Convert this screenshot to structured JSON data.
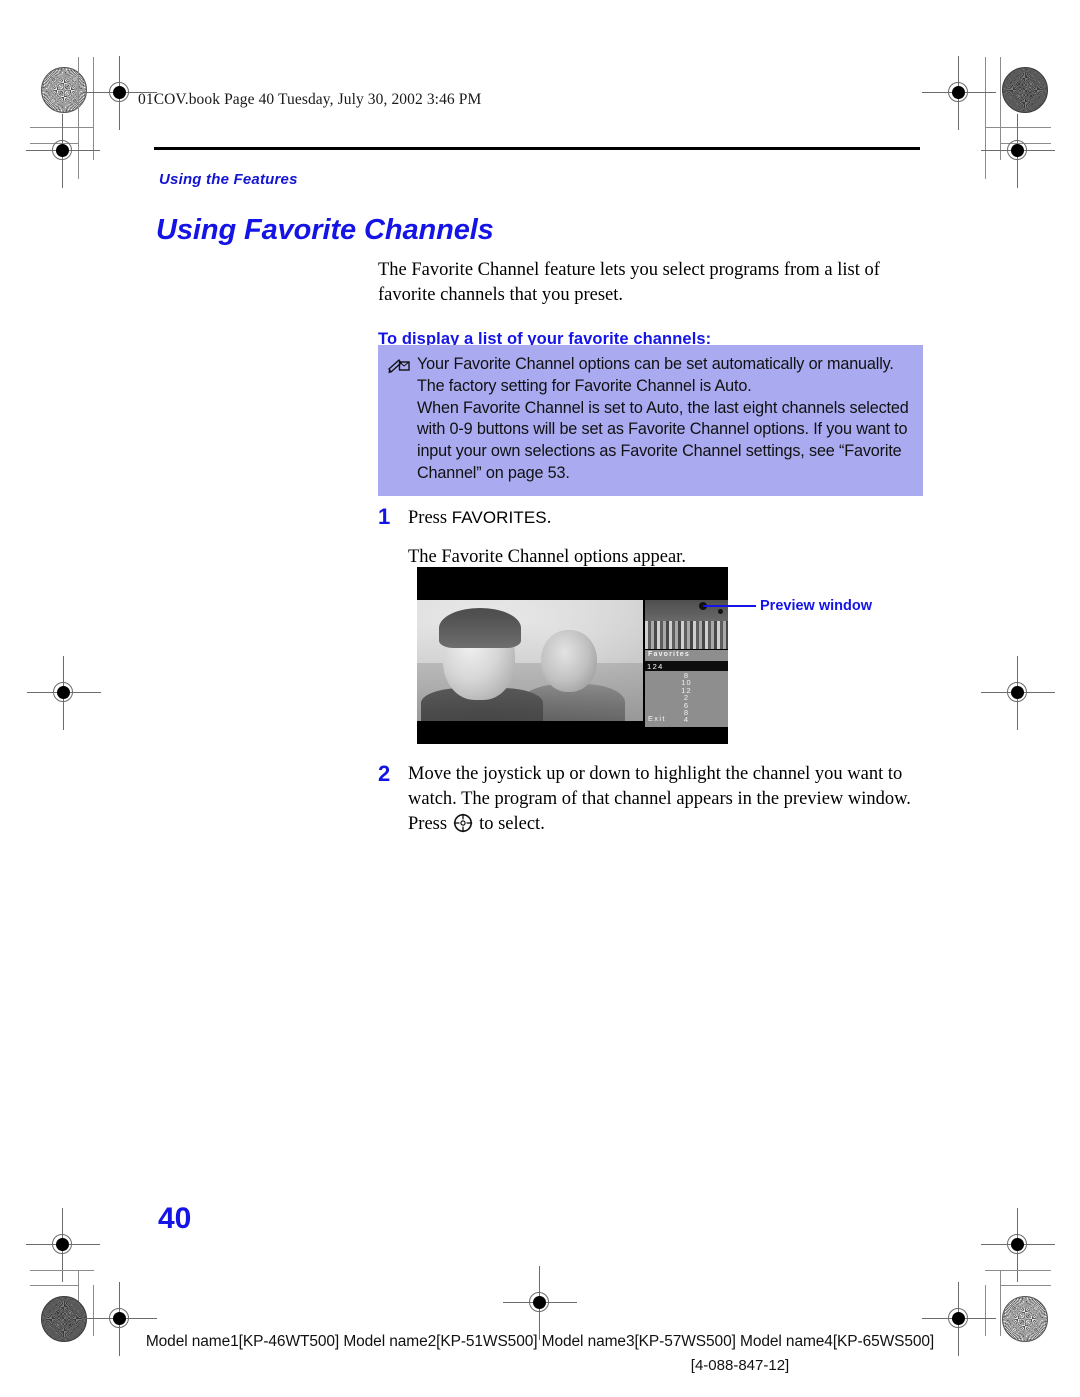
{
  "print_marks": {
    "note": "printer registration targets, halftone dots and crop marks"
  },
  "header": {
    "file_info": "01COV.book  Page 40  Tuesday, July 30, 2002  3:46 PM",
    "running_head": "Using the Features"
  },
  "title": "Using Favorite Channels",
  "intro": "The Favorite Channel feature lets you select programs from a list of favorite channels that you preset.",
  "subhead": "To display a list of your favorite channels:",
  "note_box": {
    "icon": "note-pencil-icon",
    "background": "#aaaaf0",
    "paragraphs": [
      "Your Favorite Channel options can be set automatically or manually. The factory setting for Favorite Channel is Auto.",
      "When Favorite Channel is set to Auto, the last eight channels selected with 0-9 buttons will be set as Favorite Channel options. If you want to input your own selections as Favorite Channel settings, see “Favorite Channel” on page 53."
    ]
  },
  "steps": [
    {
      "number": "1",
      "text_a": "Press ",
      "text_b": "FAVORITES",
      "text_c": ".",
      "sub": "The Favorite Channel options appear."
    },
    {
      "number": "2",
      "line1": "Move the joystick up or down to highlight the channel you want to",
      "line2": "watch. The program of that channel appears in the preview window.",
      "press_label": "Press",
      "icon": "joystick-select-icon",
      "after_icon": "to select."
    }
  ],
  "figure": {
    "callout": {
      "label": "Preview window",
      "color": "#1414e6"
    },
    "osd_menu": {
      "title": "Favorites",
      "selected_channel": "124",
      "channels": [
        "8",
        "10",
        "12",
        "2",
        "6",
        "8",
        "4"
      ],
      "exit_label": "Exit"
    }
  },
  "footer": {
    "page_number": "40",
    "models": "Model name1[KP-46WT500] Model name2[KP-51WS500] Model name3[KP-57WS500] Model name4[KP-65WS500]",
    "doc_number": "[4-088-847-12]"
  },
  "colors": {
    "heading_blue": "#1414e6",
    "note_bg": "#aaaaf0",
    "text_black": "#000000"
  }
}
